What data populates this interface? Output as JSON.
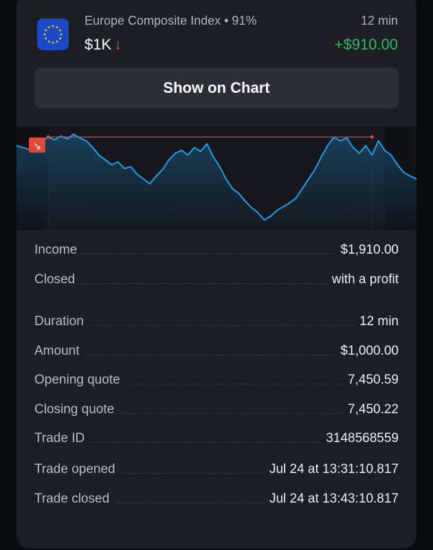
{
  "trade": {
    "asset_name": "Europe Composite Index • 91%",
    "amount": "$1K",
    "direction_icon": "arrow-down",
    "duration": "12 min",
    "profit": "+$910.00"
  },
  "button": {
    "label": "Show on Chart"
  },
  "chart_data": {
    "type": "line",
    "title": "",
    "xlabel": "",
    "ylabel": "",
    "x": [],
    "y": [
      7450.5,
      7450.48,
      7450.46,
      7450.5,
      7450.55,
      7450.59,
      7450.56,
      7450.6,
      7450.57,
      7450.62,
      7450.58,
      7450.55,
      7450.48,
      7450.4,
      7450.35,
      7450.3,
      7450.33,
      7450.26,
      7450.28,
      7450.2,
      7450.15,
      7450.1,
      7450.18,
      7450.25,
      7450.35,
      7450.42,
      7450.45,
      7450.4,
      7450.48,
      7450.44,
      7450.52,
      7450.38,
      7450.28,
      7450.15,
      7450.05,
      7450.0,
      7449.92,
      7449.85,
      7449.8,
      7449.72,
      7449.76,
      7449.82,
      7449.86,
      7449.9,
      7449.95,
      7450.05,
      7450.15,
      7450.25,
      7450.38,
      7450.5,
      7450.59,
      7450.55,
      7450.58,
      7450.48,
      7450.42,
      7450.5,
      7450.4,
      7450.55,
      7450.45,
      7450.4,
      7450.3,
      7450.22,
      7450.18,
      7450.15
    ],
    "open_index": 5,
    "close_index": 56,
    "open_quote": 7450.59,
    "line_color": "#1da1f2",
    "level_color": "#e0483c"
  },
  "details_group1": [
    {
      "label": "Income",
      "value": "$1,910.00"
    },
    {
      "label": "Closed",
      "value": "with a profit"
    }
  ],
  "details_group2": [
    {
      "label": "Duration",
      "value": "12 min"
    },
    {
      "label": "Amount",
      "value": "$1,000.00"
    },
    {
      "label": "Opening quote",
      "value": "7,450.59"
    },
    {
      "label": "Closing quote",
      "value": "7,450.22"
    },
    {
      "label": "Trade ID",
      "value": "3148568559"
    }
  ],
  "details_group3": [
    {
      "label": "Trade opened",
      "value": "Jul 24 at 13:31:10.817"
    },
    {
      "label": "Trade closed",
      "value": "Jul 24 at 13:43:10.817"
    }
  ],
  "colors": {
    "profit": "#2ebd5f",
    "loss": "#f04e3e",
    "card": "#1c1e24"
  }
}
